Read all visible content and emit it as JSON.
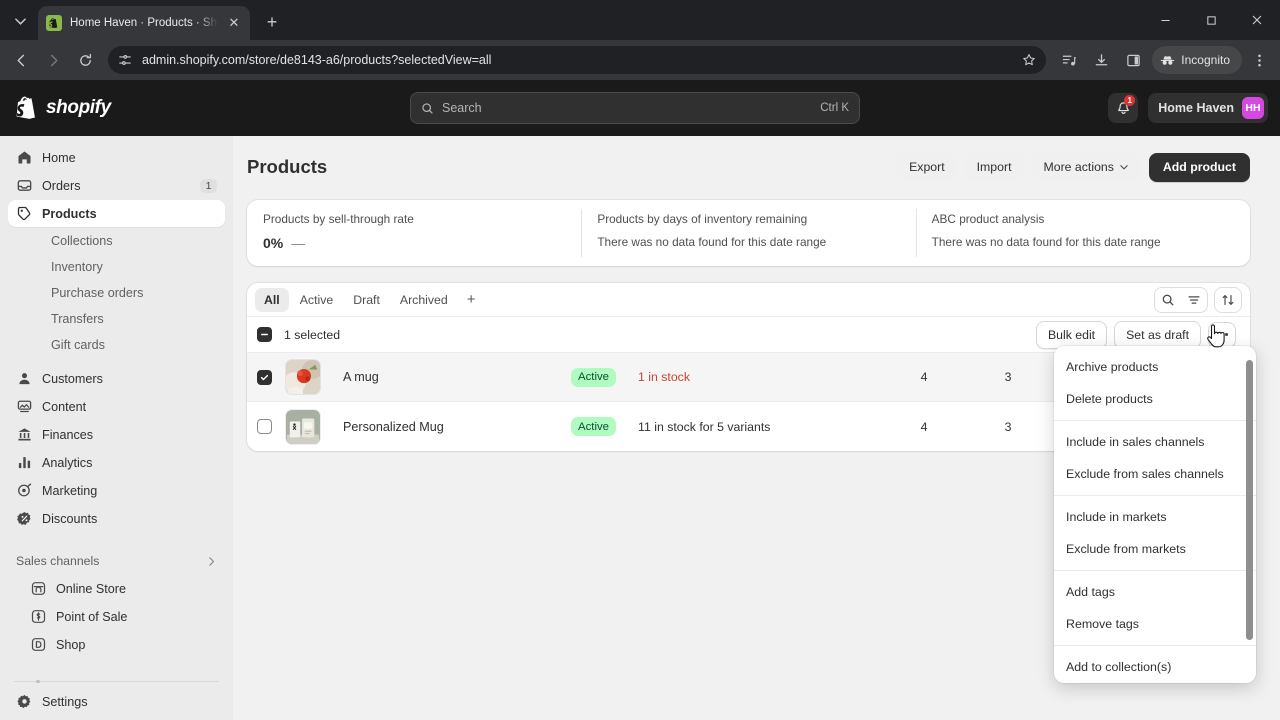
{
  "browser": {
    "tab": {
      "title": "Home Haven · Products · Shopi",
      "favicon": "shopify-favicon"
    },
    "newtab_label": "+",
    "url": "admin.shopify.com/store/de8143-a6/products?selectedView=all",
    "incognito_label": "Incognito",
    "window_controls": [
      "minimize",
      "maximize",
      "close"
    ],
    "toolbar_icons": [
      "back-arrow",
      "forward-arrow",
      "reload",
      "site-settings",
      "bookmark-star",
      "reading-list",
      "download",
      "side-panel",
      "browser-menu"
    ]
  },
  "topbar": {
    "brand": "shopify",
    "search": {
      "placeholder": "Search",
      "shortcut": "Ctrl K"
    },
    "notifications_count": "1",
    "store_name": "Home Haven",
    "avatar_initials": "HH",
    "avatar_color": "#d549e0"
  },
  "sidebar": {
    "items": [
      {
        "label": "Home",
        "icon": "home-icon"
      },
      {
        "label": "Orders",
        "icon": "orders-icon",
        "badge": "1"
      },
      {
        "label": "Products",
        "icon": "products-tag-icon",
        "active": true
      }
    ],
    "sub_items": [
      {
        "label": "Collections"
      },
      {
        "label": "Inventory"
      },
      {
        "label": "Purchase orders"
      },
      {
        "label": "Transfers"
      },
      {
        "label": "Gift cards"
      }
    ],
    "items2": [
      {
        "label": "Customers",
        "icon": "customer-icon"
      },
      {
        "label": "Content",
        "icon": "content-icon"
      },
      {
        "label": "Finances",
        "icon": "finances-bank-icon"
      },
      {
        "label": "Analytics",
        "icon": "analytics-bars-icon"
      },
      {
        "label": "Marketing",
        "icon": "marketing-icon"
      },
      {
        "label": "Discounts",
        "icon": "discounts-icon"
      }
    ],
    "sales_channels": {
      "label": "Sales channels",
      "chevron": "chevron-right-icon"
    },
    "channels": [
      {
        "label": "Online Store",
        "icon": "online-store-icon"
      },
      {
        "label": "Point of Sale",
        "icon": "point-of-sale-icon"
      },
      {
        "label": "Shop",
        "icon": "shop-icon"
      }
    ],
    "settings": {
      "label": "Settings",
      "icon": "gear-icon"
    }
  },
  "page": {
    "title": "Products",
    "actions": {
      "export": "Export",
      "import": "Import",
      "more_actions": "More actions",
      "add_product": "Add product"
    }
  },
  "metrics": [
    {
      "label": "Products by sell-through rate",
      "value": "0%",
      "delta": "—"
    },
    {
      "label": "Products by days of inventory remaining",
      "empty": "There was no data found for this date range"
    },
    {
      "label": "ABC product analysis",
      "empty": "There was no data found for this date range"
    }
  ],
  "views": {
    "tabs": [
      {
        "label": "All",
        "active": true
      },
      {
        "label": "Active",
        "active": false
      },
      {
        "label": "Draft",
        "active": false
      },
      {
        "label": "Archived",
        "active": false
      }
    ],
    "add_view": "+",
    "search_icon": "search-icon",
    "filter_icon": "filter-icon",
    "sort_icon": "sort-icon"
  },
  "bulkbar": {
    "selected_text": "1 selected",
    "checkbox_state": "indeterminate",
    "bulk_edit": "Bulk edit",
    "set_as_draft": "Set as draft",
    "more": "more-actions-kebab"
  },
  "products": [
    {
      "name": "A mug",
      "checked": true,
      "status": "Active",
      "stock": "1 in stock",
      "stock_low": true,
      "col_a": "4",
      "col_b": "3",
      "thumb": "red-flowers-mug-photo"
    },
    {
      "name": "Personalized Mug",
      "checked": false,
      "status": "Active",
      "stock": "11 in stock for 5 variants",
      "stock_low": false,
      "col_a": "4",
      "col_b": "3",
      "thumb": "personalized-mug-photo"
    }
  ],
  "dropdown": {
    "groups": [
      {
        "items": [
          "Archive products",
          "Delete products"
        ]
      },
      {
        "items": [
          "Include in sales channels",
          "Exclude from sales channels"
        ]
      },
      {
        "items": [
          "Include in markets",
          "Exclude from markets"
        ]
      },
      {
        "items": [
          "Add tags",
          "Remove tags"
        ]
      },
      {
        "items": [
          "Add to collection(s)"
        ]
      }
    ],
    "scroll_down_icon": "chevron-down-icon"
  },
  "colors": {
    "accent_dark": "#303030",
    "badge_green_bg": "#affbc0",
    "badge_green_text": "#0c5132",
    "low_stock_red": "#c8442f"
  }
}
